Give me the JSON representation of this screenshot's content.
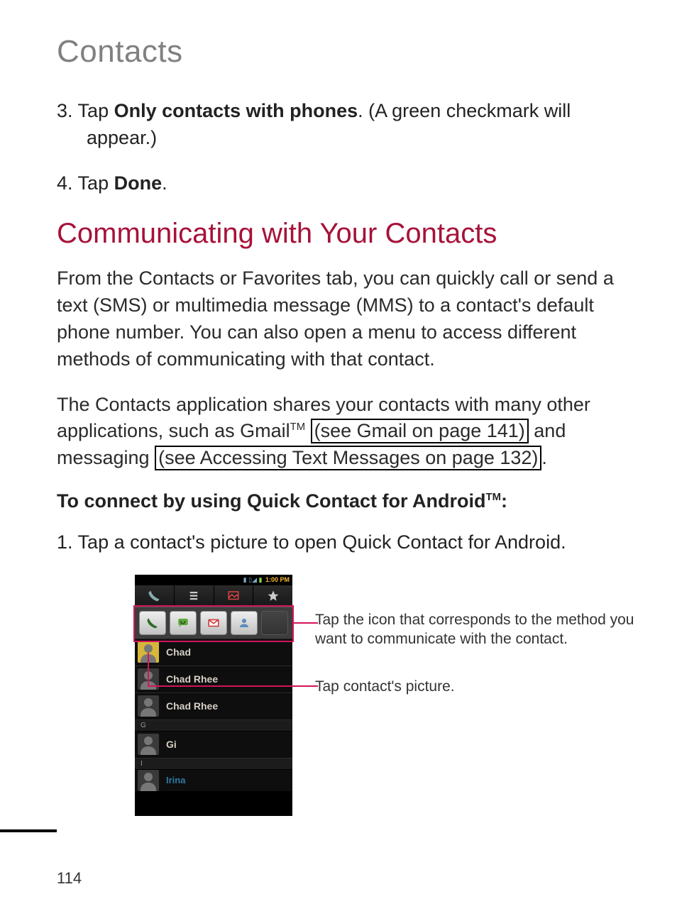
{
  "header": {
    "title": "Contacts"
  },
  "steps": {
    "s3": {
      "num": "3.",
      "pre": "Tap ",
      "bold": "Only contacts with phones",
      "post": ". (A green checkmark will appear.)"
    },
    "s4": {
      "num": "4.",
      "pre": "Tap ",
      "bold": "Done",
      "post": "."
    }
  },
  "section": {
    "heading": "Communicating with Your Contacts",
    "p1": "From the Contacts or Favorites tab, you can quickly call or send a text (SMS) or multimedia message (MMS) to a contact's default phone number. You can also open a menu to access different methods of communicating with that contact.",
    "p2_pre": "The Contacts application shares your contacts with many other applications, such as Gmail",
    "p2_tm": "TM",
    "p2_mid1": " ",
    "p2_ref1": "(see Gmail on page 141)",
    "p2_mid2": " and messaging ",
    "p2_ref2": "(see Accessing Text Messages on page 132)",
    "p2_end": ".",
    "subhead_pre": "To connect by using Quick Contact for Android",
    "subhead_tm": "TM",
    "subhead_post": ":",
    "step1": {
      "num": "1.",
      "text": "Tap a contact's picture to open Quick Contact for Android."
    }
  },
  "phone": {
    "status": {
      "signal": "▮ ▯◢",
      "battery": "▮",
      "time": "1:00 PM"
    },
    "contacts": [
      "Chad",
      "Chad Rhee",
      "Chad Rhee"
    ],
    "letter_g": "G",
    "contact_gi": "Gi",
    "letter_i": "I",
    "contact_last": "Irina"
  },
  "callouts": {
    "c1": "Tap the icon that corresponds to the method you want to communicate with the contact.",
    "c2": "Tap contact's picture."
  },
  "page_number": "114"
}
